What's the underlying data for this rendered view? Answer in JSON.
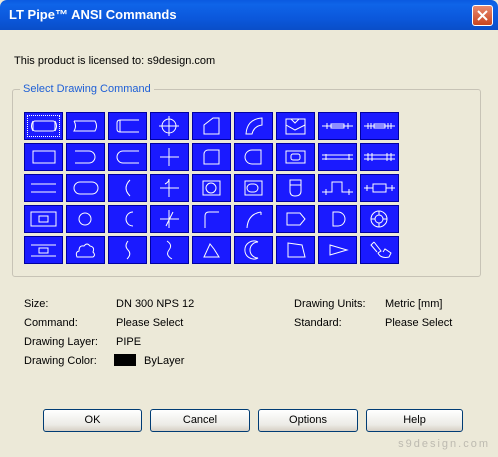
{
  "window": {
    "title": "LT Pipe™ ANSI Commands"
  },
  "license_text": "This product is licensed to: s9design.com",
  "group_label": "Select Drawing Command",
  "info": {
    "size_label": "Size:",
    "size_value": "DN 300  NPS 12",
    "units_label": "Drawing Units:",
    "units_value": "Metric [mm]",
    "command_label": "Command:",
    "command_value": "Please Select",
    "standard_label": "Standard:",
    "standard_value": "Please Select",
    "layer_label": "Drawing Layer:",
    "layer_value": "PIPE",
    "color_label": "Drawing Color:",
    "color_value": "ByLayer"
  },
  "buttons": {
    "ok": "OK",
    "cancel": "Cancel",
    "options": "Options",
    "help": "Help"
  },
  "watermark": "s9design.com",
  "colors": {
    "title_bar": "#0a58dc",
    "command_button": "#1a1aff",
    "icon_stroke": "#ffffff",
    "dialog_bg": "#ece9d8"
  },
  "command_icons": [
    [
      "pipe-end-cap-icon",
      "pipe-segment-icon",
      "pipe-open-end-icon",
      "crosshair-circle-icon",
      "chamfer-corner-icon",
      "quarter-arc-icon",
      "envelope-icon",
      "flange-pair-icon",
      "flange-pair-dark-icon"
    ],
    [
      "rectangle-icon",
      "rounded-end-icon",
      "bracket-icon",
      "cross-icon",
      "rounded-square-icon",
      "half-rounded-icon",
      "reducer-icon",
      "pipe-line-icon",
      "double-pipe-icon"
    ],
    [
      "line-icon",
      "stadium-icon",
      "arc-icon",
      "tee-cross-icon",
      "circle-in-square-icon",
      "pill-in-square-icon",
      "shield-icon",
      "valve-icon",
      "union-icon"
    ],
    [
      "inner-rect-icon",
      "circle-icon",
      "c-arc-icon",
      "diagonal-cross-icon",
      "elbow-icon",
      "sweep-elbow-icon",
      "pentagon-icon",
      "d-shape-icon",
      "bearing-icon"
    ],
    [
      "offset-rect-icon",
      "cloud-icon",
      "s-curve-icon",
      "reverse-s-icon",
      "trapezoid-icon",
      "crescent-icon",
      "irregular-quad-icon",
      "arrow-triangle-icon",
      "hand-icon"
    ]
  ]
}
